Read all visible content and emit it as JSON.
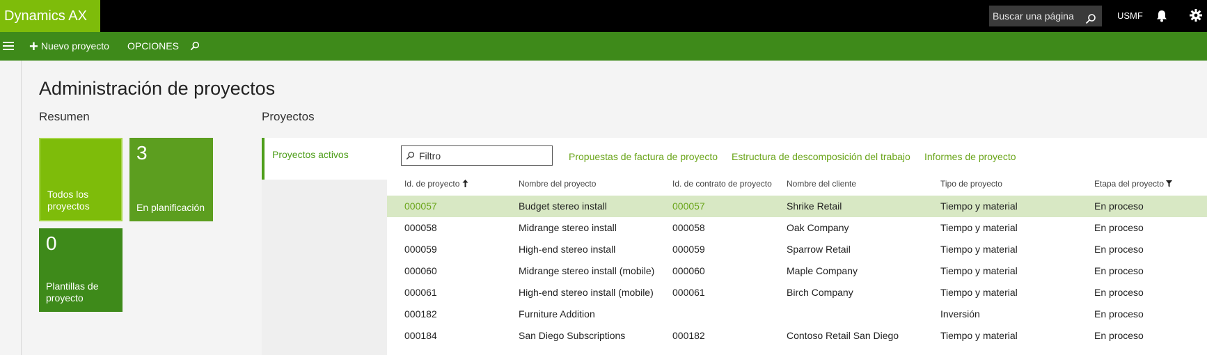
{
  "app": {
    "title": "Dynamics AX"
  },
  "topbar": {
    "search_placeholder": "Buscar una página",
    "company": "USMF"
  },
  "actionbar": {
    "new_label": "Nuevo proyecto",
    "options_label": "OPCIONES"
  },
  "page": {
    "title": "Administración de proyectos"
  },
  "summary": {
    "heading": "Resumen",
    "tiles": [
      {
        "count": "",
        "label_line1": "Todos los",
        "label_line2": "proyectos",
        "color": "#7ebc0a"
      },
      {
        "count": "3",
        "label_line1": "En planificación",
        "label_line2": "",
        "color": "#5c9e1f"
      },
      {
        "count": "0",
        "label_line1": "Plantillas de",
        "label_line2": "proyecto",
        "color": "#3e8a1a"
      }
    ]
  },
  "projects": {
    "heading": "Proyectos",
    "tab_active": "Proyectos activos",
    "filter_placeholder": "Filtro",
    "links": [
      "Propuestas de factura de proyecto",
      "Estructura de descomposición del trabajo",
      "Informes de proyecto"
    ],
    "columns": [
      "Id. de proyecto",
      "Nombre del proyecto",
      "Id. de contrato de proyecto",
      "Nombre del cliente",
      "Tipo de proyecto",
      "Etapa del proyecto"
    ],
    "rows": [
      [
        "000057",
        "Budget stereo install",
        "000057",
        "Shrike Retail",
        "Tiempo y material",
        "En proceso"
      ],
      [
        "000058",
        "Midrange stereo install",
        "000058",
        "Oak Company",
        "Tiempo y material",
        "En proceso"
      ],
      [
        "000059",
        "High-end stereo install",
        "000059",
        "Sparrow Retail",
        "Tiempo y material",
        "En proceso"
      ],
      [
        "000060",
        "Midrange stereo install (mobile)",
        "000060",
        "Maple Company",
        "Tiempo y material",
        "En proceso"
      ],
      [
        "000061",
        "High-end stereo install (mobile)",
        "000061",
        "Birch Company",
        "Tiempo y material",
        "En proceso"
      ],
      [
        "000182",
        "Furniture Addition",
        "",
        "",
        "Inversión",
        "En proceso"
      ],
      [
        "000184",
        "San Diego Subscriptions",
        "000182",
        "Contoso Retail San Diego",
        "Tiempo y material",
        "En proceso"
      ]
    ],
    "selected_row": 0
  },
  "colors": {
    "brand": "#7ebc0a",
    "actionbar": "#3e8a1a",
    "link": "#6aa51a",
    "selected_row": "#d8e8c4"
  },
  "icons": [
    "search-icon",
    "bell-icon",
    "gear-icon",
    "hamburger-icon",
    "plus-icon",
    "sort-ascending-icon",
    "filter-icon"
  ]
}
